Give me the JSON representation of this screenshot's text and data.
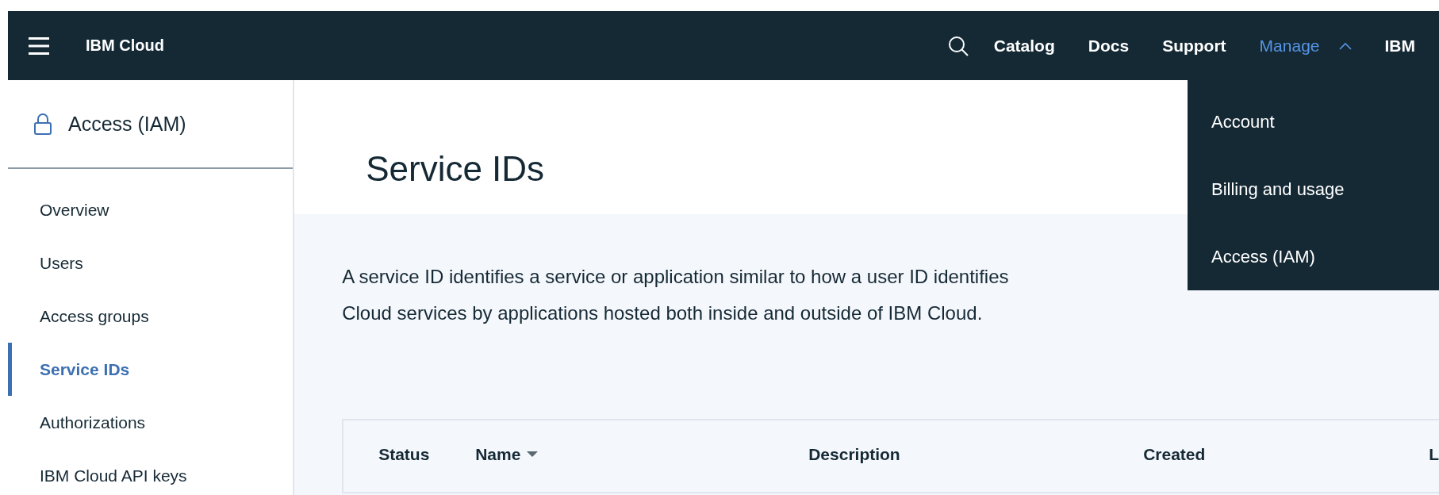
{
  "header": {
    "brand": {
      "prefix": "IBM",
      "name": "Cloud"
    },
    "nav": [
      {
        "label": "Catalog",
        "selected": false,
        "expanded": false
      },
      {
        "label": "Docs",
        "selected": false,
        "expanded": false
      },
      {
        "label": "Support",
        "selected": false,
        "expanded": false
      },
      {
        "label": "Manage",
        "selected": true,
        "expanded": true
      },
      {
        "label": "IBM",
        "selected": false,
        "expanded": false
      }
    ]
  },
  "manage_menu": {
    "items": [
      {
        "label": "Account"
      },
      {
        "label": "Billing and usage"
      },
      {
        "label": "Access (IAM)"
      }
    ]
  },
  "sidebar": {
    "title": "Access (IAM)",
    "items": [
      {
        "label": "Overview",
        "selected": false
      },
      {
        "label": "Users",
        "selected": false
      },
      {
        "label": "Access groups",
        "selected": false
      },
      {
        "label": "Service IDs",
        "selected": true
      },
      {
        "label": "Authorizations",
        "selected": false
      },
      {
        "label": "IBM Cloud API keys",
        "selected": false
      }
    ]
  },
  "page": {
    "title": "Service IDs",
    "description": [
      "A service ID identifies a service or application similar to how a user ID identifies",
      "Cloud services by applications hosted both inside and outside of IBM Cloud."
    ]
  },
  "table": {
    "columns": [
      {
        "label": "Status",
        "sorted": false
      },
      {
        "label": "Name",
        "sorted": true
      },
      {
        "label": "Description",
        "sorted": false
      },
      {
        "label": "Created",
        "sorted": false
      },
      {
        "label": "L",
        "sorted": false
      }
    ]
  }
}
